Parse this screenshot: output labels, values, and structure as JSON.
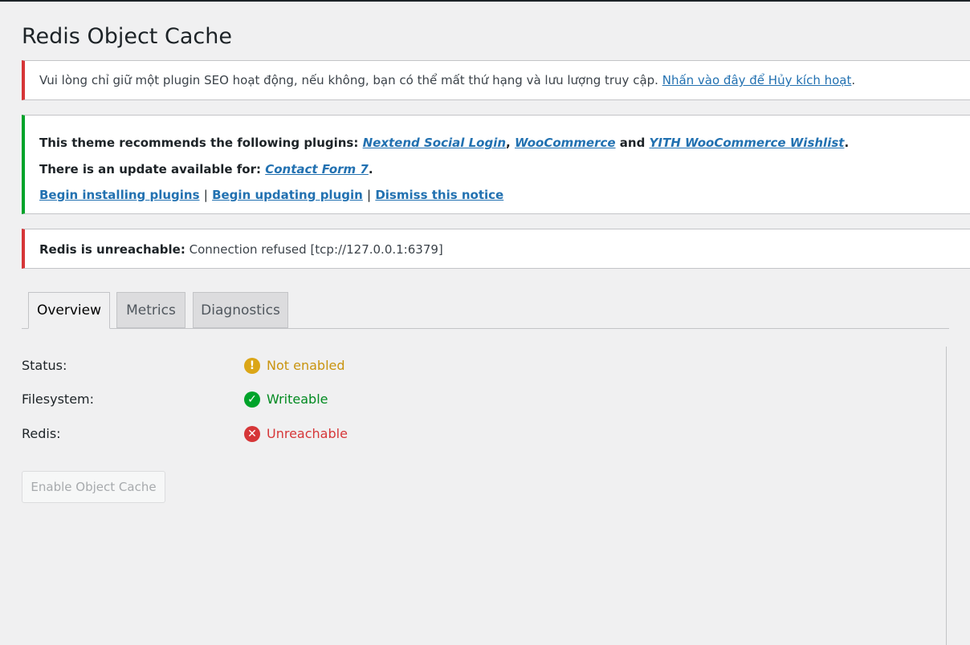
{
  "page": {
    "title": "Redis Object Cache"
  },
  "notices": {
    "seo": {
      "text": "Vui lòng chỉ giữ một plugin SEO hoạt động, nếu không, bạn có thể mất thứ hạng và lưu lượng truy cập.",
      "link": "Nhấn vào đây để Hủy kích hoạt",
      "suffix": "."
    },
    "theme": {
      "recommend_prefix": "This theme recommends the following plugins:",
      "plugin1": "Nextend Social Login",
      "sep1": ",",
      "plugin2": "WooCommerce",
      "and": "and",
      "plugin3": "YITH WooCommerce Wishlist",
      "period": ".",
      "update_prefix": "There is an update available for:",
      "update_plugin": "Contact Form 7",
      "update_period": ".",
      "action1": "Begin installing plugins",
      "sep": "|",
      "action2": "Begin updating plugin",
      "action3": "Dismiss this notice"
    },
    "redis": {
      "label": "Redis is unreachable:",
      "text": "Connection refused [tcp://127.0.0.1:6379]"
    }
  },
  "tabs": [
    {
      "label": "Overview",
      "active": true
    },
    {
      "label": "Metrics",
      "active": false
    },
    {
      "label": "Diagnostics",
      "active": false
    }
  ],
  "status_rows": [
    {
      "label": "Status:",
      "value": "Not enabled",
      "icon": "warning-icon",
      "glyph": "!",
      "color": "#dba617"
    },
    {
      "label": "Filesystem:",
      "value": "Writeable",
      "icon": "check-icon",
      "glyph": "✓",
      "color": "#00a32a"
    },
    {
      "label": "Redis:",
      "value": "Unreachable",
      "icon": "error-icon",
      "glyph": "✕",
      "color": "#d63638"
    }
  ],
  "button": {
    "enable_label": "Enable Object Cache"
  }
}
